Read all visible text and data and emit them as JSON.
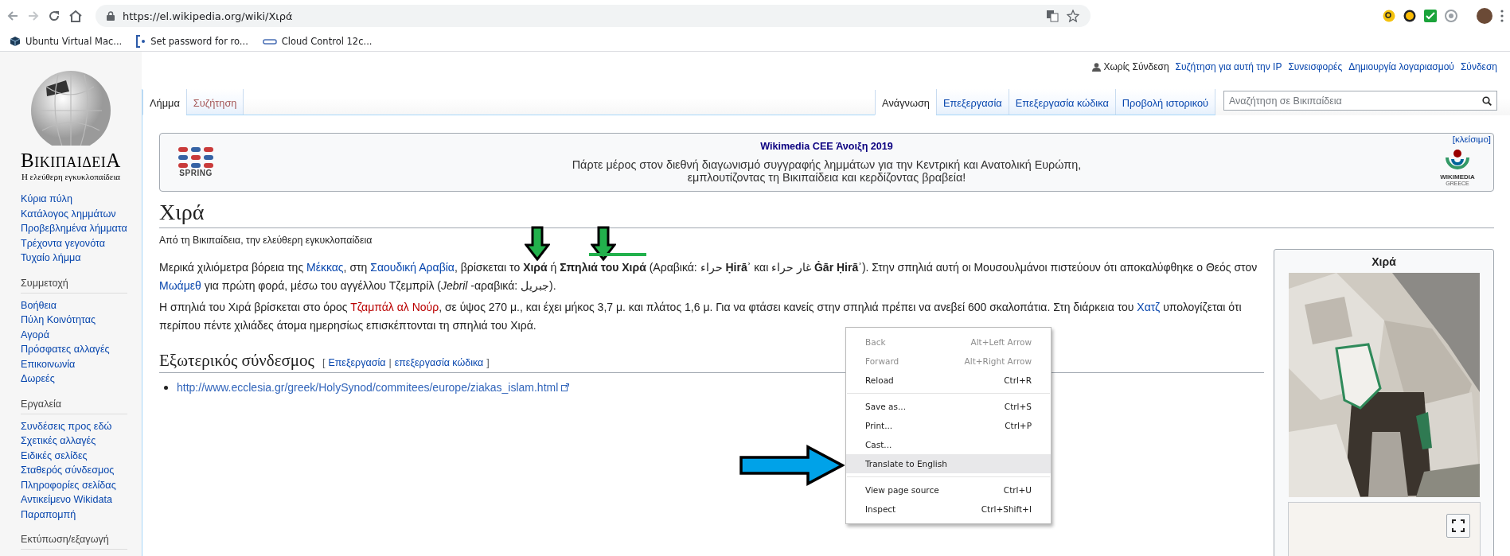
{
  "browser": {
    "url": "https://el.wikipedia.org/wiki/Χιρά",
    "bookmarks": [
      "Ubuntu Virtual Mac...",
      "Set password for ro...",
      "Cloud Control 12c..."
    ]
  },
  "sidebar": {
    "wordmark": "ΒικιπαιδειΑ",
    "tagline": "Η ελεύθερη εγκυκλοπαίδεια",
    "sections": [
      {
        "items": [
          "Κύρια πύλη",
          "Κατάλογος λημμάτων",
          "Προβεβλημένα λήμματα",
          "Τρέχοντα γεγονότα",
          "Τυχαίο λήμμα"
        ]
      },
      {
        "heading": "Συμμετοχή",
        "items": [
          "Βοήθεια",
          "Πύλη Κοινότητας",
          "Αγορά",
          "Πρόσφατες αλλαγές",
          "Επικοινωνία",
          "Δωρεές"
        ]
      },
      {
        "heading": "Εργαλεία",
        "items": [
          "Συνδέσεις προς εδώ",
          "Σχετικές αλλαγές",
          "Ειδικές σελίδες",
          "Σταθερός σύνδεσμος",
          "Πληροφορίες σελίδας",
          "Αντικείμενο Wikidata",
          "Παραπομπή"
        ]
      },
      {
        "heading": "Εκτύπωση/εξαγωγή"
      }
    ]
  },
  "personal_tools": [
    {
      "text": "Χωρίς Σύνδεση",
      "kind": "user"
    },
    {
      "text": "Συζήτηση για αυτή την IP",
      "kind": "link"
    },
    {
      "text": "Συνεισφορές",
      "kind": "link"
    },
    {
      "text": "Δημιουργία λογαριασμού",
      "kind": "link"
    },
    {
      "text": "Σύνδεση",
      "kind": "link"
    }
  ],
  "tabs_left": [
    {
      "label": "Λήμμα",
      "selected": true,
      "kind": "existing"
    },
    {
      "label": "Συζήτηση",
      "selected": false,
      "kind": "new"
    }
  ],
  "tabs_right": [
    {
      "label": "Ανάγνωση",
      "selected": true
    },
    {
      "label": "Επεξεργασία",
      "selected": false
    },
    {
      "label": "Επεξεργασία κώδικα",
      "selected": false
    },
    {
      "label": "Προβολή ιστορικού",
      "selected": false
    }
  ],
  "search": {
    "placeholder": "Αναζήτηση σε Βικιπαίδεια"
  },
  "banner": {
    "title": "Wikimedia CEE Άνοιξη 2019",
    "lines": [
      "Πάρτε μέρος στον διεθνή διαγωνισμό συγγραφής λημμάτων για την Κεντρική και Ανατολική Ευρώπη,",
      "εμπλουτίζοντας τη Βικιπαίδεια και κερδίζοντας βραβεία!"
    ],
    "close": "[κλείσιμο]",
    "left_logo_text": "SPRING",
    "right_logo_text": [
      "WIKIMEDIA",
      "GREECE"
    ]
  },
  "article": {
    "title": "Χιρά",
    "tagline": "Από τη Βικιπαίδεια, την ελεύθερη εγκυκλοπαίδεια",
    "paragraphs": [
      [
        {
          "kind": "text",
          "text": "Μερικά χιλιόμετρα βόρεια της "
        },
        {
          "kind": "link",
          "text": "Μέκκας"
        },
        {
          "kind": "text",
          "text": ", στη "
        },
        {
          "kind": "link",
          "text": "Σαουδική Αραβία"
        },
        {
          "kind": "text",
          "text": ", βρίσκεται το **Χιρά** ή **Σπηλιά του Χιρά** (Αραβικά: حراء **Ḥirāʾ** και غار حراء **Ġār Ḥirāʾ**). Στην σπηλιά αυτή οι Μουσουλμάνοι πιστεύουν ότι αποκαλύφθηκε ο Θεός στον "
        },
        {
          "kind": "link",
          "text": "Μωάμεθ"
        },
        {
          "kind": "text",
          "text": " για πρώτη φορά, μέσω του αγγέλλου Τζεμπρίλ (*Jebril* -αραβικά: جبريل)."
        }
      ],
      [
        {
          "kind": "text",
          "text": "Η σπηλιά του Χιρά βρίσκεται στο όρος "
        },
        {
          "kind": "redlink",
          "text": "Τζαμπάλ αλ Νούρ"
        },
        {
          "kind": "text",
          "text": ", σε ύψος 270 μ., και έχει μήκος 3,7 μ. και πλάτος 1,6 μ. Για να φτάσει κανείς στην σπηλιά πρέπει να ανεβεί 600 σκαλοπάτια. Στη διάρκεια του "
        },
        {
          "kind": "link",
          "text": "Χατζ"
        },
        {
          "kind": "text",
          "text": " υπολογίζεται ότι περίπου πέντε χιλιάδες άτομα ημερησίως επισκέπτονται τη σπηλιά του Χιρά."
        }
      ]
    ],
    "section_heading": "Εξωτερικός σύνδεσμος",
    "edit_open": "[",
    "edit_links": [
      "Επεξεργασία",
      "επεξεργασία κώδικα"
    ],
    "edit_sep": "|",
    "edit_close": "]",
    "external_links": [
      "http://www.ecclesia.gr/greek/HolySynod/commitees/europe/ziakas_islam.html"
    ]
  },
  "infobox": {
    "title": "Χιρά"
  },
  "context_menu": [
    {
      "kind": "item",
      "label": "Back",
      "shortcut": "Alt+Left Arrow",
      "disabled": true,
      "selected": false
    },
    {
      "kind": "item",
      "label": "Forward",
      "shortcut": "Alt+Right Arrow",
      "disabled": true,
      "selected": false
    },
    {
      "kind": "item",
      "label": "Reload",
      "shortcut": "Ctrl+R",
      "disabled": false,
      "selected": false
    },
    {
      "kind": "separator"
    },
    {
      "kind": "item",
      "label": "Save as...",
      "shortcut": "Ctrl+S",
      "disabled": false,
      "selected": false
    },
    {
      "kind": "item",
      "label": "Print...",
      "shortcut": "Ctrl+P",
      "disabled": false,
      "selected": false
    },
    {
      "kind": "item",
      "label": "Cast...",
      "disabled": false,
      "selected": false
    },
    {
      "kind": "item",
      "label": "Translate to English",
      "disabled": false,
      "selected": true
    },
    {
      "kind": "separator"
    },
    {
      "kind": "item",
      "label": "View page source",
      "shortcut": "Ctrl+U",
      "disabled": false,
      "selected": false
    },
    {
      "kind": "item",
      "label": "Inspect",
      "shortcut": "Ctrl+Shift+I",
      "disabled": false,
      "selected": false
    }
  ],
  "annotations": [
    {
      "kind": "down_arrow",
      "color": "#22b14c"
    },
    {
      "kind": "down_arrow",
      "color": "#22b14c"
    },
    {
      "kind": "underline",
      "color": "#22b14c"
    },
    {
      "kind": "right_arrow",
      "color": "#00a2e8"
    }
  ]
}
